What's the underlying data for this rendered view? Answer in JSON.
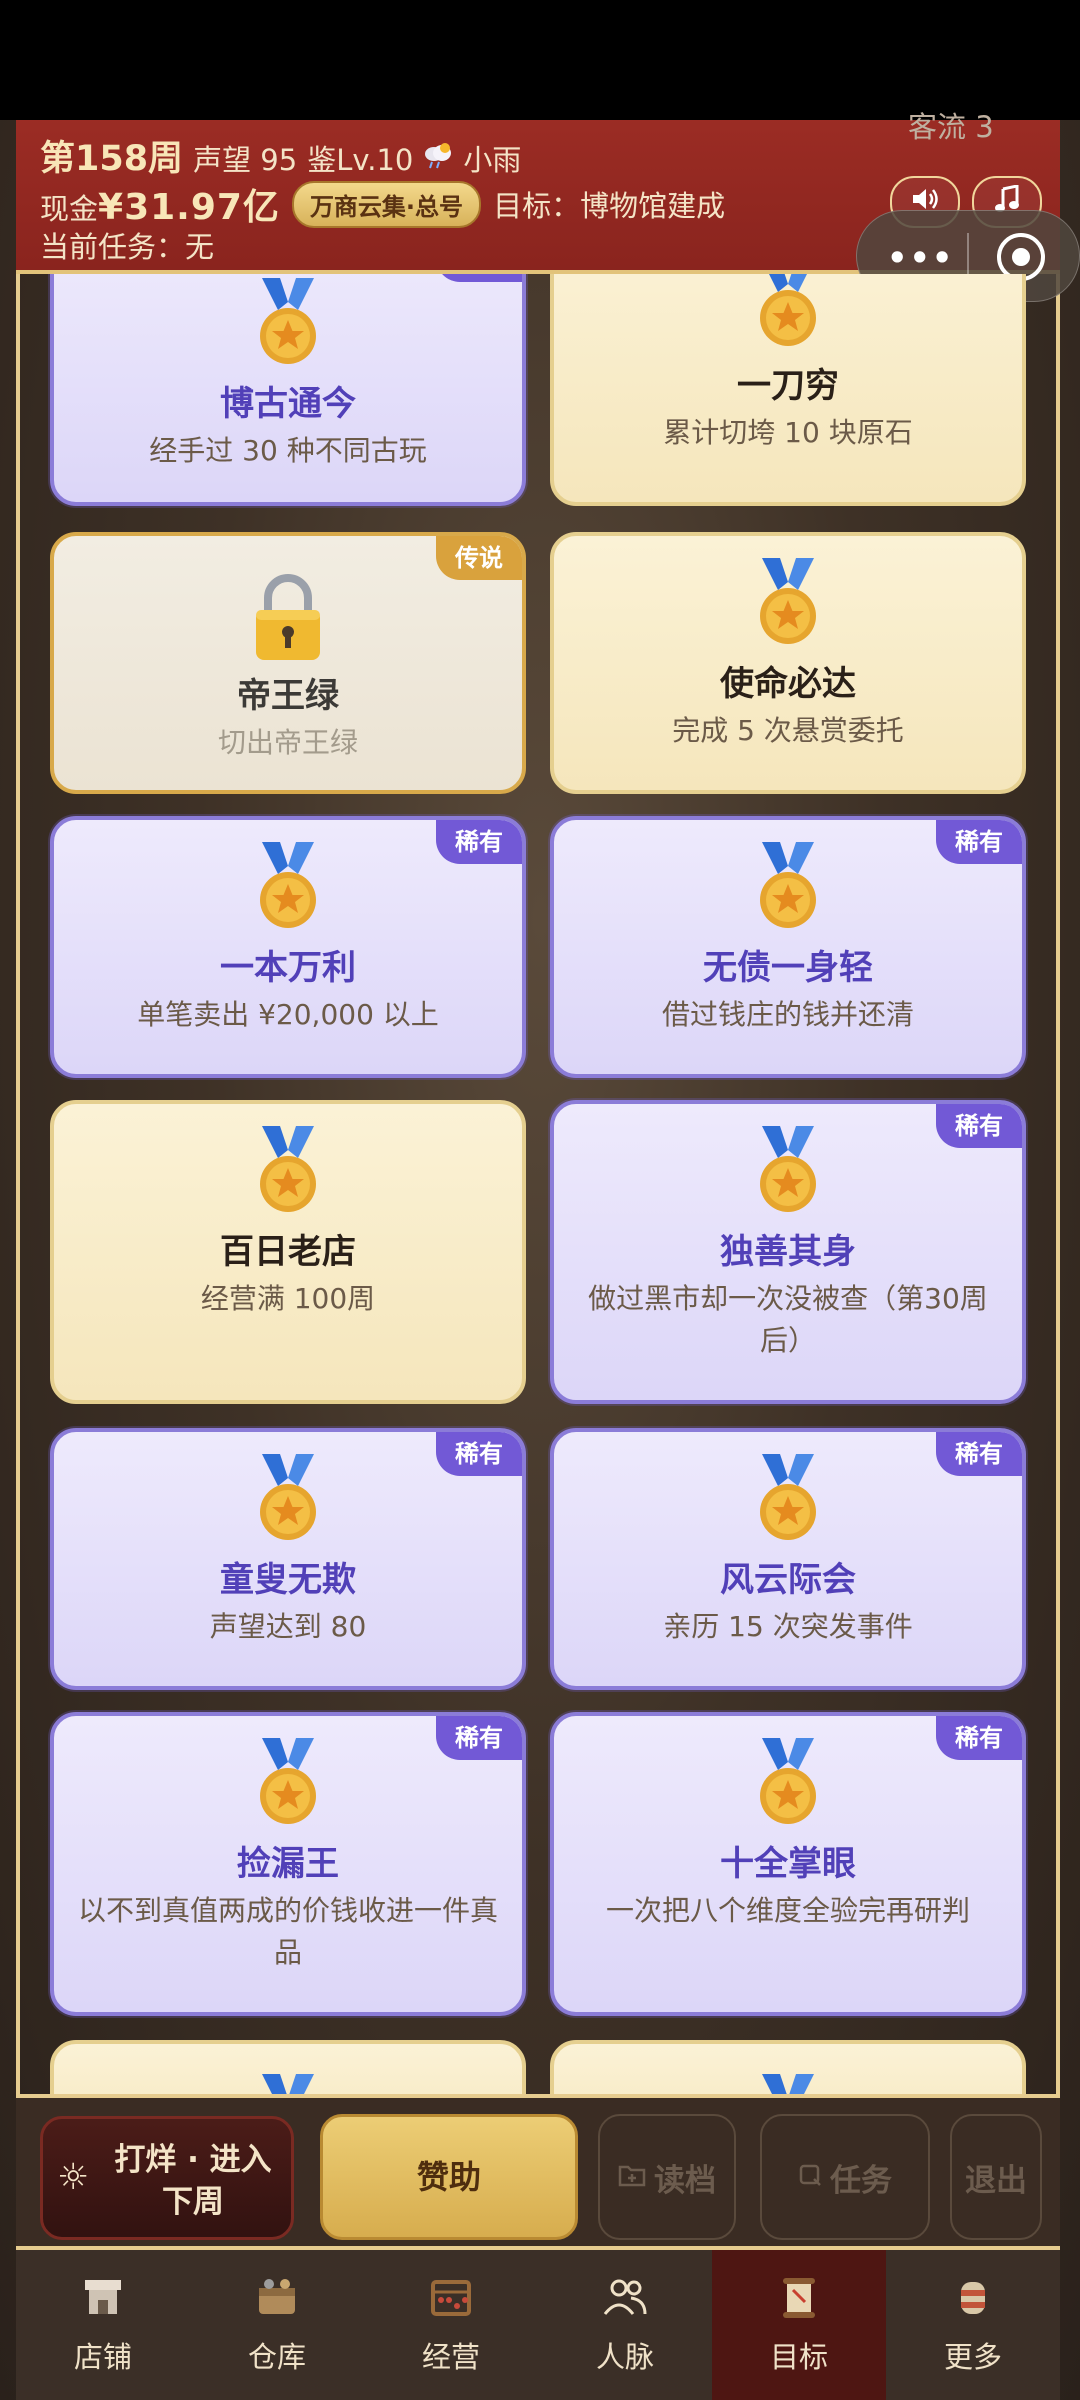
{
  "header": {
    "week": "第158周",
    "reputation": "声望 95",
    "appraisal": "鉴Lv.10",
    "weather_icon": "rain-cloud-icon",
    "weather": "小雨",
    "cash_label": "现金",
    "cash": "¥31.97亿",
    "store_badge": "万商云集·总号",
    "goal": "目标：博物馆建成",
    "task": "当前任务：无",
    "visitors": "客流 3",
    "sound_icon": "speaker-icon",
    "music_icon": "music-note-icon"
  },
  "capsule": {
    "dots": "•••"
  },
  "cards": [
    {
      "title": "博古通今",
      "desc": "经手过 30 种不同古玩",
      "rarity": "rare",
      "tag": "稀有"
    },
    {
      "title": "一刀穷",
      "desc": "累计切垮 10 块原石",
      "rarity": "common",
      "tag": ""
    },
    {
      "title": "帝王绿",
      "desc": "切出帝王绿",
      "rarity": "legend",
      "tag": "传说",
      "locked": true
    },
    {
      "title": "使命必达",
      "desc": "完成 5 次悬赏委托",
      "rarity": "common",
      "tag": ""
    },
    {
      "title": "一本万利",
      "desc": "单笔卖出 ¥20,000 以上",
      "rarity": "rare",
      "tag": "稀有"
    },
    {
      "title": "无债一身轻",
      "desc": "借过钱庄的钱并还清",
      "rarity": "rare",
      "tag": "稀有"
    },
    {
      "title": "百日老店",
      "desc": "经营满 100周",
      "rarity": "common",
      "tag": ""
    },
    {
      "title": "独善其身",
      "desc": "做过黑市却一次没被查（第30周后）",
      "rarity": "rare",
      "tag": "稀有"
    },
    {
      "title": "童叟无欺",
      "desc": "声望达到 80",
      "rarity": "rare",
      "tag": "稀有"
    },
    {
      "title": "风云际会",
      "desc": "亲历 15 次突发事件",
      "rarity": "rare",
      "tag": "稀有"
    },
    {
      "title": "捡漏王",
      "desc": "以不到真值两成的价钱收进一件真品",
      "rarity": "rare",
      "tag": "稀有"
    },
    {
      "title": "十全掌眼",
      "desc": "一次把八个维度全验完再研判",
      "rarity": "rare",
      "tag": "稀有"
    },
    {
      "title": "",
      "desc": "",
      "rarity": "common",
      "tag": ""
    },
    {
      "title": "",
      "desc": "",
      "rarity": "common",
      "tag": ""
    }
  ],
  "actions": {
    "next_week": "打烊 · 进入\n下周",
    "support": "赞助",
    "load": "读档",
    "task": "任务",
    "exit": "退出"
  },
  "nav": [
    {
      "label": "店铺",
      "icon": "shop-icon"
    },
    {
      "label": "仓库",
      "icon": "warehouse-icon"
    },
    {
      "label": "经营",
      "icon": "abacus-icon"
    },
    {
      "label": "人脉",
      "icon": "people-icon"
    },
    {
      "label": "目标",
      "icon": "scroll-icon",
      "active": true
    },
    {
      "label": "更多",
      "icon": "more-icon"
    }
  ],
  "colors": {
    "header_red": "#8a241e",
    "gold": "#e6cc8f",
    "rare_purple": "#7259d6",
    "legend_gold": "#d9a23d"
  }
}
